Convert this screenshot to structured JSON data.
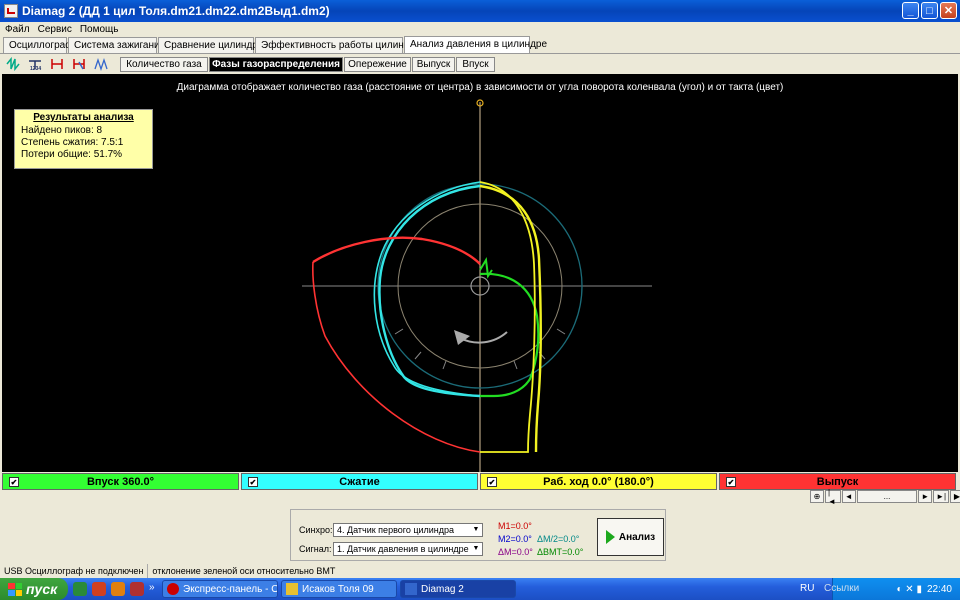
{
  "window": {
    "title": "Diamag 2 (ДД 1 цил Толя.dm21.dm22.dm2Выд1.dm2)"
  },
  "menu": [
    "Файл",
    "Сервис",
    "Помощь"
  ],
  "main_tabs": [
    {
      "label": "Осциллограф",
      "w": 64
    },
    {
      "label": "Система зажигания",
      "w": 89
    },
    {
      "label": "Сравнение цилиндров",
      "w": 96
    },
    {
      "label": "Эффективность работы цилиндров",
      "w": 148
    },
    {
      "label": "Анализ давления в цилиндре",
      "w": 126
    }
  ],
  "toolbar_icons": [
    "spark-icon",
    "counter-icon",
    "marker-icon",
    "marker-cursor-icon",
    "compare-icon"
  ],
  "sub_tabs": [
    {
      "label": "Количество газа",
      "w": 88
    },
    {
      "label": "Фазы газораспределения",
      "w": 134
    },
    {
      "label": "Опережение",
      "w": 67
    },
    {
      "label": "Выпуск",
      "w": 43
    },
    {
      "label": "Впуск",
      "w": 39
    }
  ],
  "diagram": {
    "caption": "Диаграмма отображает количество газа (расстояние от центра) в зависимости от угла поворота коленвала (угол) и от такта (цвет)"
  },
  "results": {
    "title": "Результаты анализа",
    "peaks": "Найдено пиков: 8",
    "compression": "Степень сжатия: 7.5:1",
    "losses": "Потери общие: 51.7%"
  },
  "phases": [
    {
      "label": "Впуск 360.0°",
      "color": "#33ff33",
      "checked": true
    },
    {
      "label": "Сжатие",
      "color": "#33ffff",
      "checked": true
    },
    {
      "label": "Раб. ход 0.0° (180.0°)",
      "color": "#ffff33",
      "checked": true
    },
    {
      "label": "Выпуск",
      "color": "#ff3333",
      "checked": true
    }
  ],
  "nav": [
    "⊕",
    "|◄",
    "◄",
    "...",
    "►",
    "►|",
    "▶"
  ],
  "controls": {
    "sync_label": "Синхро:",
    "sync_value": "4. Датчик первого цилиндра",
    "signal_label": "Сигнал:",
    "signal_value": "1. Датчик давления в цилиндре",
    "m1": "M1=0.0°",
    "m2": "M2=0.0°",
    "dm": "ΔM=0.0°",
    "dm2": "ΔM/2=0.0°",
    "dbmt": "ΔBMT=0.0°",
    "analyze": "Анализ"
  },
  "status": {
    "usb": "USB Осциллограф не подключен",
    "msg": "отклонение зеленой оси относительно BMT"
  },
  "taskbar": {
    "start": "пуск",
    "tasks": [
      {
        "label": "Экспресс-панель - О...",
        "icon": "#c00"
      },
      {
        "label": "Исаков Толя 09",
        "icon": "#e8c030"
      },
      {
        "label": "Diamag 2",
        "icon": "#36c"
      }
    ],
    "lang": "RU",
    "links": "Ссылки",
    "clock": "22:40"
  },
  "chart_data": {
    "type": "polar-line",
    "title": "Диаграмма отображает количество газа (расстояние от центра) в зависимости от угла поворота коленвала (угол) и от такта (цвет)",
    "series": [
      {
        "name": "Впуск",
        "color": "#33ff33"
      },
      {
        "name": "Сжатие",
        "color": "#33ffff"
      },
      {
        "name": "Раб. ход",
        "color": "#ffff33"
      },
      {
        "name": "Выпуск",
        "color": "#ff3333"
      }
    ]
  }
}
